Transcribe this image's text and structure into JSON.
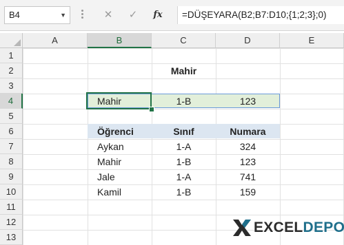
{
  "formula_bar": {
    "name_box": "B4",
    "name_box_dropdown": "▼",
    "cancel_icon": "✕",
    "enter_icon": "✓",
    "fx_label": "fx",
    "formula": "=DÜŞEYARA(B2;B7:D10;{1;2;3};0)"
  },
  "columns": [
    "A",
    "B",
    "C",
    "D",
    "E"
  ],
  "rows": [
    "1",
    "2",
    "3",
    "4",
    "5",
    "6",
    "7",
    "8",
    "9",
    "10",
    "11",
    "12",
    "13"
  ],
  "selection": {
    "active_cell": "B4",
    "active_column": "B",
    "active_row": "4",
    "accent_color": "#217346"
  },
  "cells": {
    "lookup_value": "Mahir",
    "result": {
      "ogrenci": "Mahir",
      "sinif": "1-B",
      "numara": "123"
    },
    "table_header": {
      "ogrenci": "Öğrenci",
      "sinif": "Sınıf",
      "numara": "Numara"
    },
    "table_rows": [
      {
        "ogrenci": "Aykan",
        "sinif": "1-A",
        "numara": "324"
      },
      {
        "ogrenci": "Mahir",
        "sinif": "1-B",
        "numara": "123"
      },
      {
        "ogrenci": "Jale",
        "sinif": "1-A",
        "numara": "741"
      },
      {
        "ogrenci": "Kamil",
        "sinif": "1-B",
        "numara": "159"
      }
    ]
  },
  "logo": {
    "part1": "EXCEL",
    "part2": "DEPO",
    "icon": "x-logo-icon"
  },
  "colors": {
    "header_fill": "#dce6f1",
    "result_fill": "#e2efda",
    "logo_blue": "#1f6f8b"
  }
}
